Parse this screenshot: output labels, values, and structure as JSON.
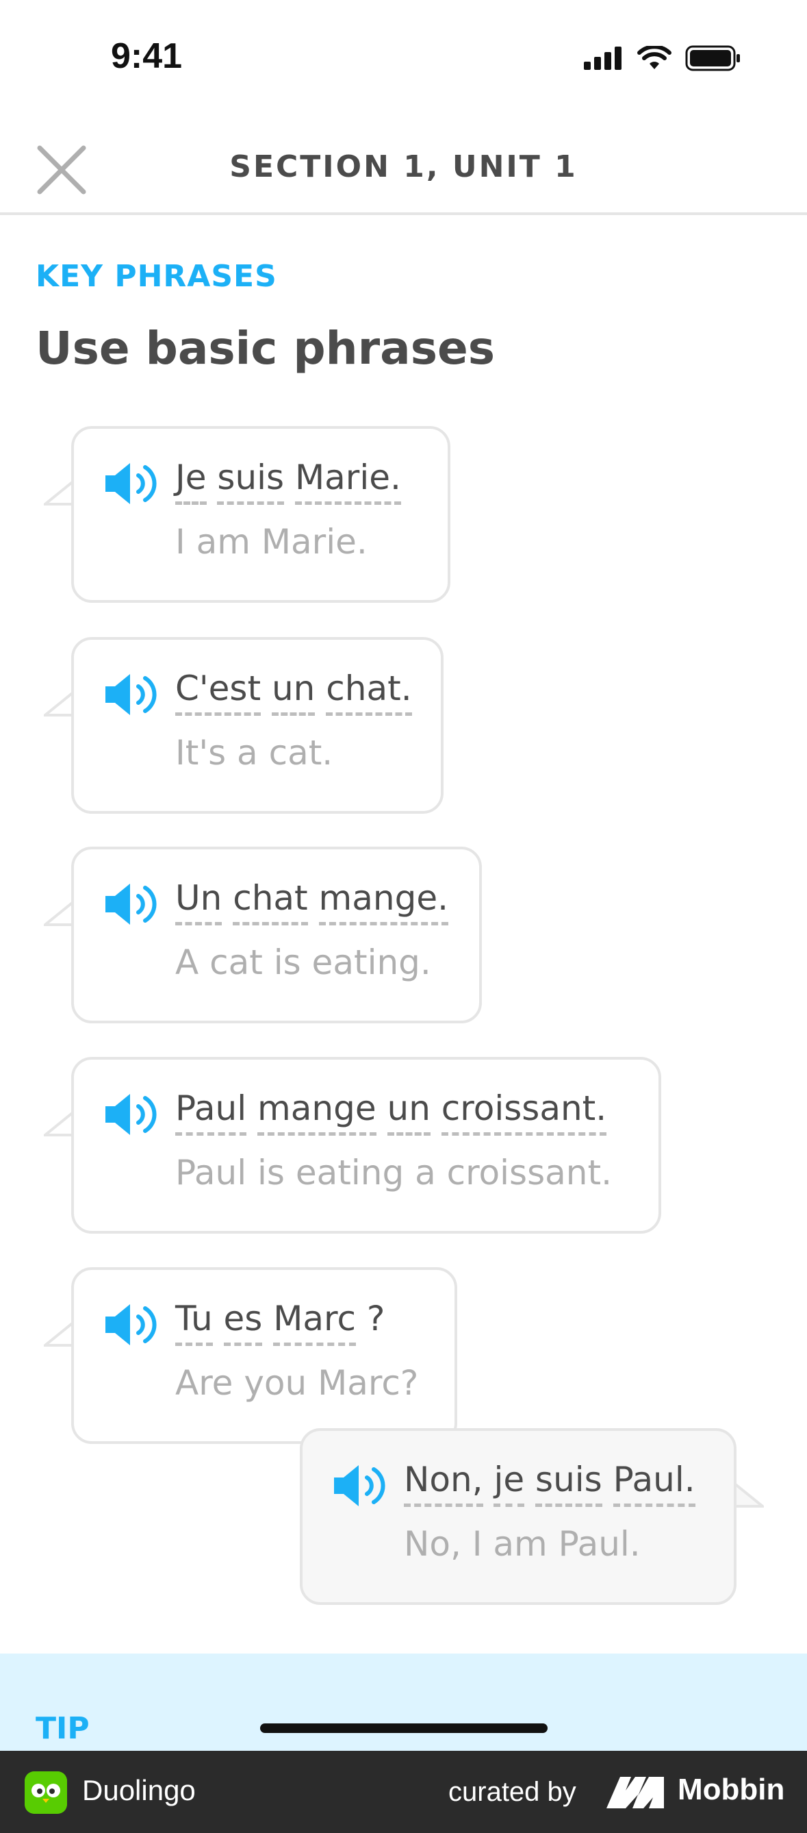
{
  "status_bar": {
    "time": "9:41"
  },
  "header": {
    "title": "SECTION 1, UNIT 1"
  },
  "kicker": "KEY PHRASES",
  "title": "Use basic phrases",
  "phrases": [
    {
      "words": [
        "Je",
        "suis",
        "Marie."
      ],
      "translation": "I am Marie."
    },
    {
      "words": [
        "C'est",
        "un",
        "chat."
      ],
      "translation": "It's a cat."
    },
    {
      "words": [
        "Un",
        "chat",
        "mange."
      ],
      "translation": "A cat is eating."
    },
    {
      "words": [
        "Paul",
        "mange",
        "un",
        "croissant."
      ],
      "translation": "Paul is eating a croissant."
    },
    {
      "words": [
        "Tu",
        "es",
        "Marc",
        "?"
      ],
      "translation": "Are you Marc?"
    },
    {
      "words": [
        "Non,",
        "je",
        "suis",
        "Paul."
      ],
      "translation": "No, I am Paul."
    }
  ],
  "tip": {
    "label": "TIP"
  },
  "footer": {
    "app_name": "Duolingo",
    "curated_by": "curated by",
    "brand": "Mobbin"
  },
  "colors": {
    "accent": "#1cb0f6",
    "text": "#4b4b4b",
    "muted": "#afafaf",
    "tip_bg": "#ddf4ff"
  }
}
